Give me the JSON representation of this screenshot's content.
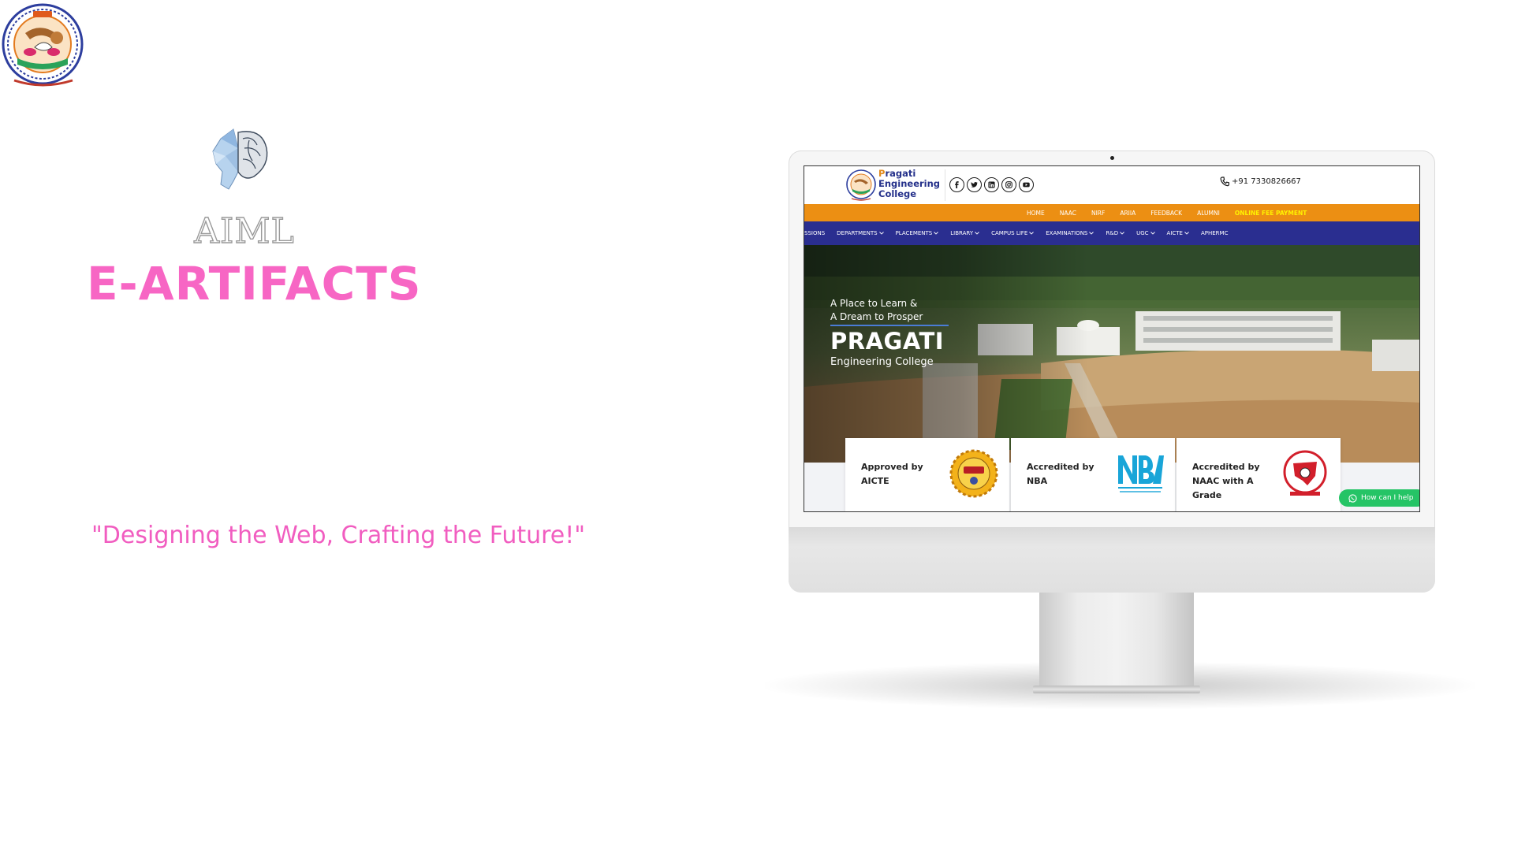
{
  "branding": {
    "aiml_label": "AIML",
    "title": "E-ARTIFACTS",
    "tagline": "\"Designing the Web, Crafting the Future!\"",
    "accent_color": "#f766c4"
  },
  "website": {
    "college_name": {
      "line1_first": "P",
      "line1_rest": "ragati",
      "line2": "Engineering",
      "line3": "College"
    },
    "social_icons": [
      "facebook-icon",
      "twitter-icon",
      "linkedin-icon",
      "instagram-icon",
      "youtube-icon"
    ],
    "phone": "+91 7330826667",
    "top_nav": [
      "HOME",
      "NAAC",
      "NIRF",
      "ARIIA",
      "FEEDBACK",
      "ALUMNI"
    ],
    "fee_link": "ONLINE FEE PAYMENT",
    "main_nav": [
      {
        "label": "SSIONS",
        "dropdown": false
      },
      {
        "label": "DEPARTMENTS",
        "dropdown": true
      },
      {
        "label": "PLACEMENTS",
        "dropdown": true
      },
      {
        "label": "LIBRARY",
        "dropdown": true
      },
      {
        "label": "CAMPUS LIFE",
        "dropdown": true
      },
      {
        "label": "EXAMINATIONS",
        "dropdown": true
      },
      {
        "label": "R&D",
        "dropdown": true
      },
      {
        "label": "UGC",
        "dropdown": true
      },
      {
        "label": "AICTE",
        "dropdown": true
      },
      {
        "label": "APHERMC",
        "dropdown": false
      }
    ],
    "hero": {
      "line1": "A Place to Learn &",
      "line2": "A Dream to Prosper",
      "title": "PRAGATI",
      "subtitle": "Engineering College"
    },
    "cards": [
      {
        "line1": "Approved by",
        "line2": "AICTE",
        "badge": "aicte-logo-icon"
      },
      {
        "line1": "Accredited by",
        "line2": "NBA",
        "badge": "nba-logo-icon"
      },
      {
        "line1": "Accredited by",
        "line2": "NAAC with A Grade",
        "badge": "naac-logo-icon"
      }
    ],
    "whatsapp_label": "How can I help",
    "colors": {
      "orange_bar": "#ec8f13",
      "blue_bar": "#2a2e90",
      "fee_link": "#fff200",
      "whatsapp": "#25c466"
    }
  }
}
